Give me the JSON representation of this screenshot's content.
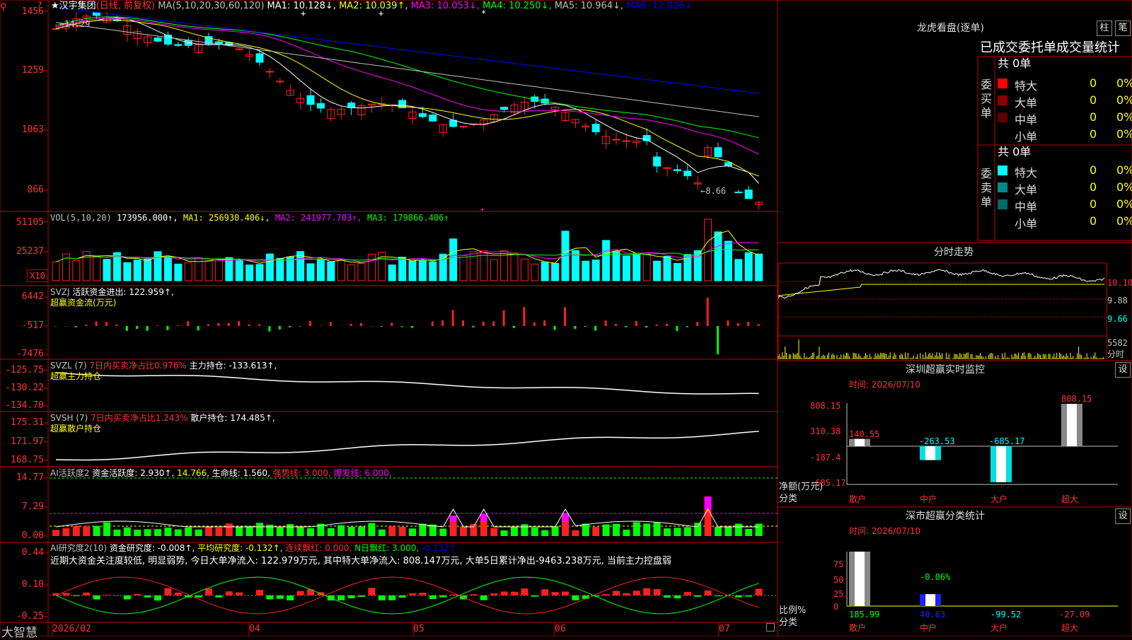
{
  "main": {
    "stock_name": "★汉宇集团",
    "mode": "(日线, 前复权)",
    "ma_formula": "MA(5,10,20,30,60,120)",
    "ma1": "MA1: 10.128↓,",
    "ma2": "MA2: 10.039↑,",
    "ma3": "MA3: 10.053↓,",
    "ma4": "MA4: 10.250↓,",
    "ma5": "MA5: 10.964↓,",
    "ma6": "MA6: 12.026↓",
    "y_labels": [
      "1456",
      "1259",
      "1063",
      "866"
    ],
    "high_marker": "14.29",
    "low_marker": "←8.66"
  },
  "vol": {
    "title": "VOL(5,10,20)",
    "value": "173956.000↑,",
    "ma1": "MA1: 256930.406↓,",
    "ma2": "MA2: 241977.703↑,",
    "ma3": "MA3: 179866.406↑",
    "y_labels": [
      "51105",
      "25237"
    ],
    "unit": "X10"
  },
  "svzj": {
    "title": "SVZJ",
    "text": "活跃资金进出: 122.959↑,",
    "subtitle": "超赢资金流(万元)",
    "y_labels": [
      "6442",
      "-517",
      "-7476"
    ]
  },
  "svzl": {
    "title": "SVZL (7)",
    "ratio": "7日内买卖净占比0.976%",
    "hold": "主力持仓: -133.613↑,",
    "subtitle": "超赢主力持仓",
    "y_labels": [
      "-125.75",
      "-130.22",
      "-134.70"
    ]
  },
  "svsh": {
    "title": "SVSH (7)",
    "ratio": "7日内买卖净占比1.243%",
    "hold": "散户持仓: 174.485↑,",
    "subtitle": "超赢散户持仓",
    "y_labels": [
      "175.31",
      "171.97",
      "168.75"
    ]
  },
  "ai1": {
    "title": "AI活跃度2",
    "a": "资金活跃度: 2.930↑,",
    "b": "14.766,",
    "c": "生命线: 1.560,",
    "d": "强势线: 3.000,",
    "e": "爆发线: 6.000,",
    "y_labels": [
      "14.77",
      "7.29",
      "0.00"
    ]
  },
  "ai2": {
    "title": "AI研究度2(10)",
    "a": "资金研究度: -0.008↑,",
    "b": "平均研究度: -0.132↑,",
    "c": "连续飘红: 0.000,",
    "d": "N日飘红: 3.000,",
    "e": "-0.132↑",
    "commentary": "近期大资金关注度较低, 明显弱势, 今日大单净流入: 122.979万元, 其中特大单净流入: 808.147万元, 大单5日累计净出-9463.238万元, 当前主力控盘弱",
    "y_labels": [
      "0.44",
      "0.10",
      "-0.25"
    ]
  },
  "x_axis": [
    "2026/02",
    "04",
    "05",
    "06",
    "07"
  ],
  "brand": "大智慧",
  "right": {
    "lh_title": "龙虎看盘(逐单)",
    "btn_zhu": "柱",
    "btn_bi": "笔",
    "lh_header": "已成交委托单成交量统计",
    "buy_label": "委买单",
    "sell_label": "委卖单",
    "buy_total": "共 0单",
    "sell_total": "共 0单",
    "buy_rows": [
      {
        "name": "特大",
        "count": "0",
        "pct": "0%",
        "color": "#ff0000"
      },
      {
        "name": "大单",
        "count": "0",
        "pct": "0%",
        "color": "#8b0000"
      },
      {
        "name": "中单",
        "count": "0",
        "pct": "0%",
        "color": "#5a0000"
      },
      {
        "name": "小单",
        "count": "0",
        "pct": "0%",
        "color": "#000000"
      }
    ],
    "sell_rows": [
      {
        "name": "特大",
        "count": "0",
        "pct": "0%",
        "color": "#00ffff"
      },
      {
        "name": "大单",
        "count": "0",
        "pct": "0%",
        "color": "#008b8b"
      },
      {
        "name": "中单",
        "count": "0",
        "pct": "0%",
        "color": "#006b6b"
      },
      {
        "name": "小单",
        "count": "0",
        "pct": "0%",
        "color": "#000000"
      }
    ],
    "intraday_title": "分时走势",
    "intraday_y": [
      "10.10",
      "9.88",
      "9.66"
    ],
    "intraday_vol": "5582",
    "intraday_vol_unit": "分时",
    "monitor_title": "深圳超赢实时监控",
    "monitor_btn": "设",
    "monitor_time": "时间: 2026/07/10",
    "monitor_y": [
      "808.15",
      "310.38",
      "-187.4",
      "-685.17"
    ],
    "monitor_values": [
      "140.55",
      "-263.53",
      "-685.17",
      "808.15"
    ],
    "monitor_axis_title": "净额(万元)",
    "monitor_axis_sub": "分类",
    "monitor_cats": [
      "散户",
      "中户",
      "大户",
      "超大"
    ],
    "stat_title": "深市超赢分类统计",
    "stat_btn": "设",
    "stat_time": "时间: 2026/07/10",
    "stat_y": [
      "75",
      "50",
      "25",
      "0"
    ],
    "stat_mid_label": "-0.06%",
    "stat_values": [
      "185.99",
      "40.63",
      "-99.52",
      "-27.09"
    ],
    "stat_axis_title": "比例%",
    "stat_axis_sub": "分类",
    "stat_cats": [
      "散户",
      "中户",
      "大户",
      "超大"
    ]
  },
  "colors": {
    "up": "#ff2020",
    "down": "#00ffff",
    "border": "#c00000",
    "ma1": "#ffffff",
    "ma2": "#ffff00",
    "ma3": "#ff00ff",
    "ma4": "#00ff00",
    "ma5": "#c0c0c0",
    "ma6": "#0000ff"
  }
}
